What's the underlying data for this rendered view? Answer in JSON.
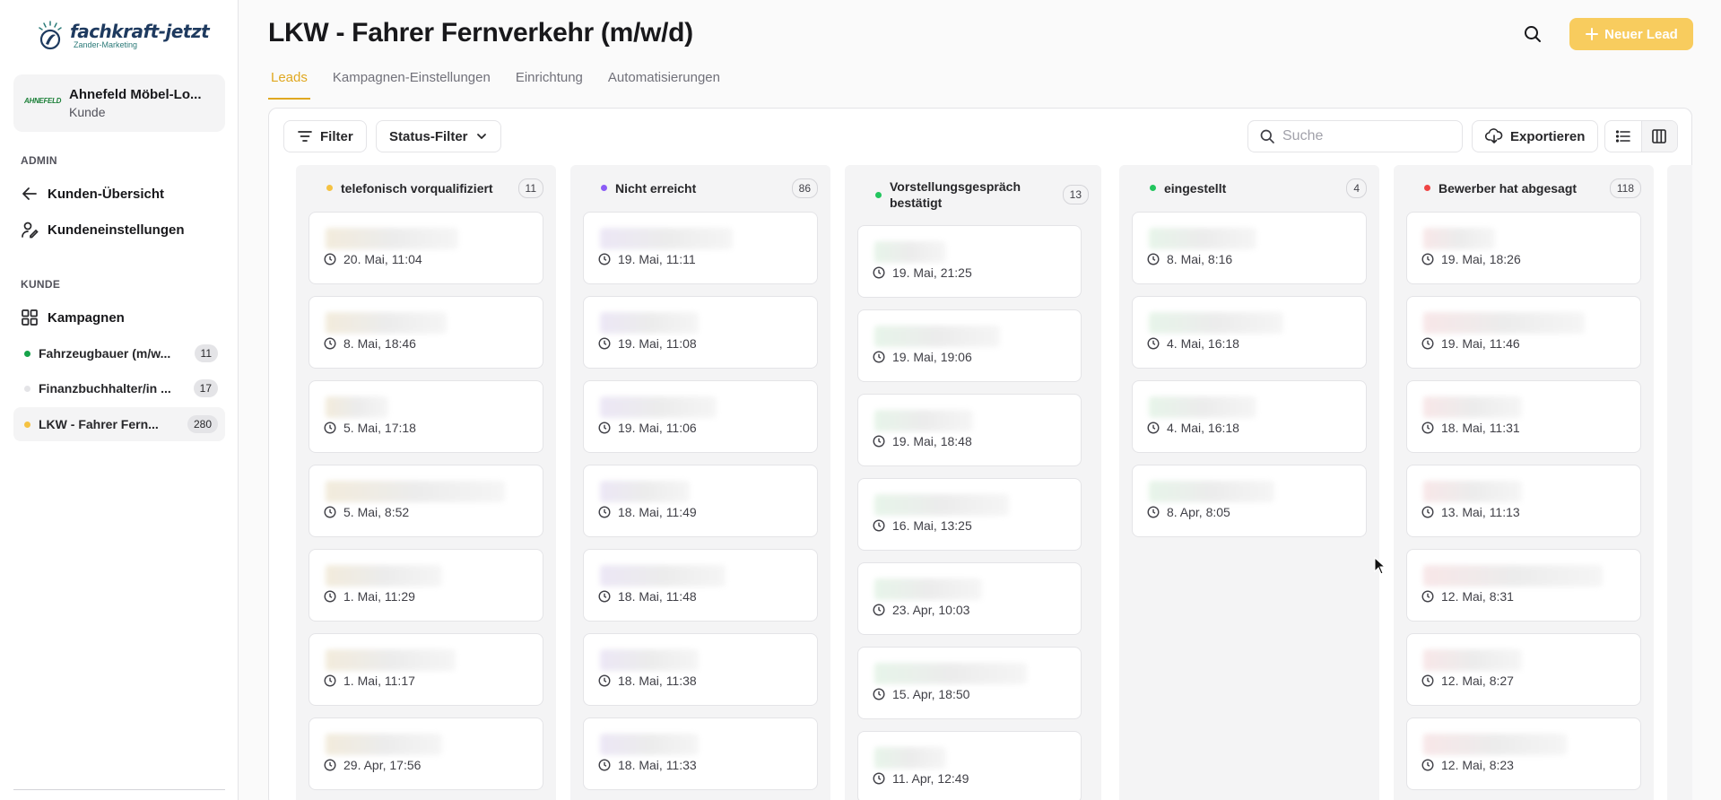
{
  "sidebar": {
    "logo": {
      "main": "fachkraft-jetzt",
      "sub": "Zander-Marketing"
    },
    "client": {
      "logo_text": "AHNEFELD",
      "name": "Ahnefeld Möbel-Lo...",
      "role": "Kunde"
    },
    "admin_label": "ADMIN",
    "admin_items": [
      {
        "label": "Kunden-Übersicht",
        "icon": "arrow-left-icon"
      },
      {
        "label": "Kundeneinstellungen",
        "icon": "user-settings-icon"
      }
    ],
    "kunde_label": "KUNDE",
    "kampagnen_label": "Kampagnen",
    "campaigns": [
      {
        "label": "Fahrzeugbauer (m/w...",
        "count": "11",
        "dot": "#16a34a"
      },
      {
        "label": "Finanzbuchhalter/in ...",
        "count": "17",
        "dot": "#e4e4e7"
      },
      {
        "label": "LKW - Fahrer Fern...",
        "count": "280",
        "dot": "#f5c242"
      }
    ]
  },
  "header": {
    "title": "LKW - Fahrer Fernverkehr (m/w/d)",
    "new_lead": "Neuer Lead",
    "accent": "#f8cc5e"
  },
  "tabs": [
    "Leads",
    "Kampagnen-Einstellungen",
    "Einrichtung",
    "Automatisierungen"
  ],
  "toolbar": {
    "filter": "Filter",
    "status_filter": "Status-Filter",
    "search_placeholder": "Suche",
    "export": "Exportieren"
  },
  "columns": [
    {
      "title": "telefonisch vorqualifiziert",
      "count": "11",
      "dot": "#f5c242",
      "cards": [
        "20. Mai, 11:04",
        "8. Mai, 18:46",
        "5. Mai, 17:18",
        "5. Mai, 8:52",
        "1. Mai, 11:29",
        "1. Mai, 11:17",
        "29. Apr, 17:56"
      ]
    },
    {
      "title": "Nicht erreicht",
      "count": "86",
      "dot": "#8b5cf6",
      "cards": [
        "19. Mai, 11:11",
        "19. Mai, 11:08",
        "19. Mai, 11:06",
        "18. Mai, 11:49",
        "18. Mai, 11:48",
        "18. Mai, 11:38",
        "18. Mai, 11:33"
      ]
    },
    {
      "title": "Vorstellungsgespräch bestätigt",
      "count": "13",
      "dot": "#22c55e",
      "cards": [
        "19. Mai, 21:25",
        "19. Mai, 19:06",
        "19. Mai, 18:48",
        "16. Mai, 13:25",
        "23. Apr, 10:03",
        "15. Apr, 18:50",
        "11. Apr, 12:49"
      ]
    },
    {
      "title": "eingestellt",
      "count": "4",
      "dot": "#22c55e",
      "cards": [
        "8. Mai, 8:16",
        "4. Mai, 16:18",
        "4. Mai, 16:18",
        "8. Apr, 8:05"
      ]
    },
    {
      "title": "Bewerber hat abgesagt",
      "count": "118",
      "dot": "#ef4444",
      "cards": [
        "19. Mai, 18:26",
        "19. Mai, 11:46",
        "18. Mai, 11:31",
        "13. Mai, 11:13",
        "12. Mai, 8:31",
        "12. Mai, 8:27",
        "12. Mai, 8:23"
      ]
    }
  ]
}
